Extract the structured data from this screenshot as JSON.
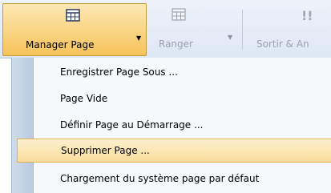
{
  "toolbar": {
    "manager_label": "Manager Page",
    "ranger_label": "Ranger",
    "sortir_label": "Sortir & An",
    "manager_icon": "grid-table-icon",
    "ranger_icon": "grid-table-icon",
    "sortir_icon": "exclamation-icon"
  },
  "menu": {
    "items": [
      {
        "label": "Enregistrer Page Sous ..."
      },
      {
        "label": "Page Vide"
      },
      {
        "label": "Définir Page au Démarrage ..."
      },
      {
        "label": "Supprimer Page ...",
        "selected": true
      },
      {
        "label": "Chargement du système page par défaut"
      }
    ]
  },
  "colors": {
    "highlight": "#f9dc9a",
    "highlight_border": "#e3b24a",
    "strip": "#c4d4e8"
  }
}
